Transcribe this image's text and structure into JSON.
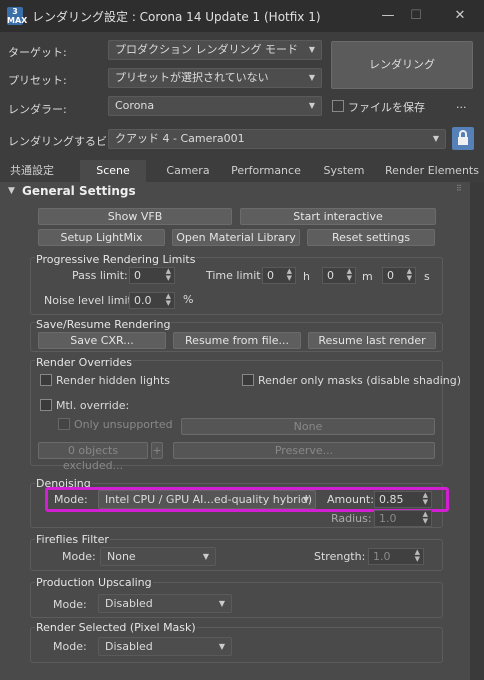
{
  "window": {
    "title": "レンダリング設定 : Corona 14 Update 1 (Hotfix 1)",
    "icon_text": "3\nMAX",
    "min": "—",
    "max": "☐",
    "close": "✕"
  },
  "top": {
    "target_label": "ターゲット:",
    "target_value": "プロダクション レンダリング モード",
    "preset_label": "プリセット:",
    "preset_value": "プリセットが選択されていない",
    "renderer_label": "レンダラー:",
    "renderer_value": "Corona",
    "render_button": "レンダリング",
    "save_file_label": "ファイルを保存",
    "more": "...",
    "view_label": "レンダリングするビュー:",
    "view_value": "クアッド 4 - Camera001"
  },
  "tabs": [
    "共通設定",
    "Scene",
    "Camera",
    "Performance",
    "System",
    "Render Elements"
  ],
  "general": {
    "title": "General Settings",
    "show_vfb": "Show VFB",
    "start_interactive": "Start interactive",
    "setup_lightmix": "Setup LightMix",
    "open_material_library": "Open Material Library",
    "reset_settings": "Reset settings"
  },
  "progressive": {
    "title": "Progressive Rendering Limits",
    "pass_label": "Pass limit:",
    "pass_value": "0",
    "time_label": "Time limit:",
    "h_value": "0",
    "h": "h",
    "m_value": "0",
    "m": "m",
    "s_value": "0",
    "s": "s",
    "noise_label": "Noise level limit:",
    "noise_value": "0.0",
    "percent": "%"
  },
  "save_resume": {
    "title": "Save/Resume Rendering",
    "save_cxr": "Save CXR...",
    "resume_file": "Resume from file...",
    "resume_last": "Resume last render"
  },
  "overrides": {
    "title": "Render Overrides",
    "hidden_lights": "Render hidden lights",
    "only_masks": "Render only masks (disable shading)",
    "mtl_override": "Mtl. override:",
    "only_unsupported": "Only unsupported",
    "none": "None",
    "excluded": "0 objects excluded...",
    "plus": "+",
    "preserve": "Preserve..."
  },
  "denoising": {
    "title": "Denoising",
    "mode_label": "Mode:",
    "mode_value": "Intel CPU / GPU AI...ed-quality hybrid)",
    "amount_label": "Amount:",
    "amount_value": "0.85",
    "radius_label": "Radius:",
    "radius_value": "1.0"
  },
  "fireflies": {
    "title": "Fireflies Filter",
    "mode_label": "Mode:",
    "mode_value": "None",
    "strength_label": "Strength:",
    "strength_value": "1.0"
  },
  "upscaling": {
    "title": "Production Upscaling",
    "mode_label": "Mode:",
    "mode_value": "Disabled"
  },
  "selected": {
    "title": "Render Selected (Pixel Mask)",
    "mode_label": "Mode:",
    "mode_value": "Disabled"
  },
  "colors": {
    "highlight": "#d21fd2",
    "panel": "#4a4a4a",
    "titlebar": "#2e2e2e"
  }
}
